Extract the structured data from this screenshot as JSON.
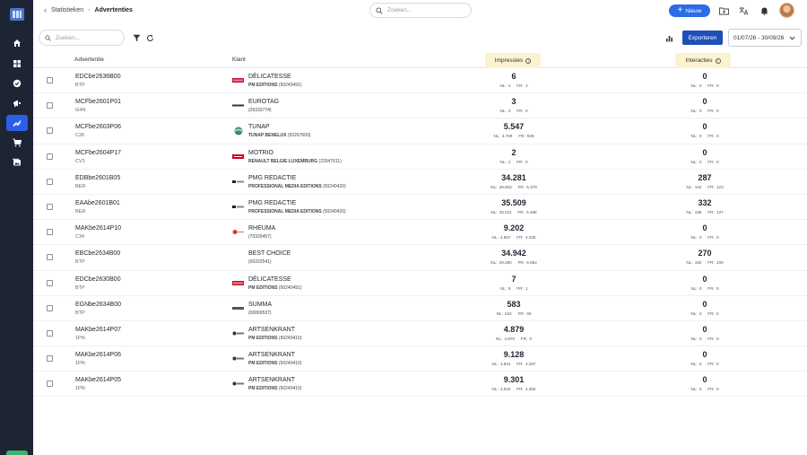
{
  "breadcrumb": {
    "parent": "Statistieken",
    "current": "Advertenties"
  },
  "top_search": {
    "placeholder": "Zoeken..."
  },
  "new_button": {
    "label": "Nieuw"
  },
  "toolbar": {
    "search_placeholder": "Zoeken...",
    "export_label": "Exporteren",
    "date_range": "01/07/26 - 30/09/26"
  },
  "table": {
    "headers": {
      "ad": "Advertentie",
      "client": "Klant",
      "impressions": "Impressies",
      "interactions": "Interacties"
    },
    "rows": [
      {
        "code": "EDCbe2636B00",
        "sub": "BTP",
        "logo": "delicatesse-logo",
        "client": "DÉLICATESSE",
        "client_sub_bold": "PM EDITIONS",
        "client_sub_id": "(50240491)",
        "imp": "6",
        "imp_nl": "NL: 4",
        "imp_fr": "FR: 2",
        "int": "0",
        "int_nl": "NL: 0",
        "int_fr": "FR: 0"
      },
      {
        "code": "MCFbe2601P01",
        "sub": "G4N",
        "logo": "eurotag-logo",
        "client": "EUROTAG",
        "client_sub_bold": "",
        "client_sub_id": "(26333774)",
        "imp": "3",
        "imp_nl": "NL: 3",
        "imp_fr": "FR: 0",
        "int": "0",
        "int_nl": "NL: 0",
        "int_fr": "FR: 0"
      },
      {
        "code": "MCFbe2603P06",
        "sub": "C26",
        "logo": "tunap-logo",
        "client": "TUNAP",
        "client_sub_bold": "TUNAP BENELUX",
        "client_sub_id": "(93267600)",
        "imp": "5.547",
        "imp_nl": "NL: 4.709",
        "imp_fr": "FR: 838",
        "int": "0",
        "int_nl": "NL: 0",
        "int_fr": "FR: 0"
      },
      {
        "code": "MCFbe2604P17",
        "sub": "CV1",
        "logo": "motrio-logo",
        "client": "MOTRIO",
        "client_sub_bold": "RENAULT BELGIE LUXEMBURG",
        "client_sub_id": "(23347611)",
        "imp": "2",
        "imp_nl": "NL: 2",
        "imp_fr": "FR: 0",
        "int": "0",
        "int_nl": "NL: 0",
        "int_fr": "FR: 0"
      },
      {
        "code": "EDBbe2601B05",
        "sub": "BER",
        "logo": "pmg-logo",
        "client": "PMG REDACTIE",
        "client_sub_bold": "PROFESSIONAL MEDIA EDITIONS",
        "client_sub_id": "(50240420)",
        "imp": "34.281",
        "imp_nl": "NL: 28.903",
        "imp_fr": "FR: 5.378",
        "int": "287",
        "int_nl": "NL: 164",
        "int_fr": "FR: 123"
      },
      {
        "code": "EAAbe2601B01",
        "sub": "BER",
        "logo": "pmg-logo",
        "client": "PMG REDACTIE",
        "client_sub_bold": "PROFESSIONAL MEDIA EDITIONS",
        "client_sub_id": "(50240420)",
        "imp": "35.509",
        "imp_nl": "NL: 30.011",
        "imp_fr": "FR: 5.498",
        "int": "332",
        "int_nl": "NL: 195",
        "int_fr": "FR: 137"
      },
      {
        "code": "MAKbe2614P10",
        "sub": "C34",
        "logo": "rheuma-logo",
        "client": "RHEUMA",
        "client_sub_bold": "",
        "client_sub_id": "(70329457)",
        "imp": "9.202",
        "imp_nl": "NL: 4.867",
        "imp_fr": "FR: 4.335",
        "int": "0",
        "int_nl": "NL: 0",
        "int_fr": "FR: 0"
      },
      {
        "code": "EBCbe2634B00",
        "sub": "BTP",
        "logo": "",
        "client": "BEST CHOICE",
        "client_sub_bold": "",
        "client_sub_id": "(00222541)",
        "imp": "34.942",
        "imp_nl": "NL: 29.360",
        "imp_fr": "FR: 5.582",
        "int": "270",
        "int_nl": "NL: 162",
        "int_fr": "FR: 108"
      },
      {
        "code": "EDCbe2630B00",
        "sub": "BTP",
        "logo": "delicatesse-logo",
        "client": "DÉLICATESSE",
        "client_sub_bold": "PM EDITIONS",
        "client_sub_id": "(50240491)",
        "imp": "7",
        "imp_nl": "NL: 6",
        "imp_fr": "FR: 1",
        "int": "0",
        "int_nl": "NL: 0",
        "int_fr": "FR: 0"
      },
      {
        "code": "EGNbe2634B00",
        "sub": "BTP",
        "logo": "summa-logo",
        "client": "SUMMA",
        "client_sub_bold": "",
        "client_sub_id": "(00069537)",
        "imp": "583",
        "imp_nl": "NL: 534",
        "imp_fr": "FR: 49",
        "int": "0",
        "int_nl": "NL: 0",
        "int_fr": "FR: 0"
      },
      {
        "code": "MAKbe2614P07",
        "sub": "1PN",
        "logo": "artsenkrant-logo",
        "client": "ARTSENKRANT",
        "client_sub_bold": "PM EDITIONS",
        "client_sub_id": "(50240410)",
        "imp": "4.879",
        "imp_nl": "NL: 4.879",
        "imp_fr": "FR: 0",
        "int": "0",
        "int_nl": "NL: 0",
        "int_fr": "FR: 0"
      },
      {
        "code": "MAKbe2614P06",
        "sub": "1PN",
        "logo": "artsenkrant-logo",
        "client": "ARTSENKRANT",
        "client_sub_bold": "PM EDITIONS",
        "client_sub_id": "(50240410)",
        "imp": "9.128",
        "imp_nl": "NL: 4.831",
        "imp_fr": "FR: 4.297",
        "int": "0",
        "int_nl": "NL: 0",
        "int_fr": "FR: 0"
      },
      {
        "code": "MAKbe2614P05",
        "sub": "1PN",
        "logo": "artsenkrant-logo",
        "client": "ARTSENKRANT",
        "client_sub_bold": "PM EDITIONS",
        "client_sub_id": "(50240410)",
        "imp": "9.301",
        "imp_nl": "NL: 4.919",
        "imp_fr": "FR: 4.382",
        "int": "0",
        "int_nl": "NL: 0",
        "int_fr": "FR: 0"
      }
    ]
  },
  "colors": {
    "sidebar": "#1d2535",
    "accent": "#2c6ce8",
    "export": "#1f4fb8",
    "highlight": "#fbf3cf"
  }
}
